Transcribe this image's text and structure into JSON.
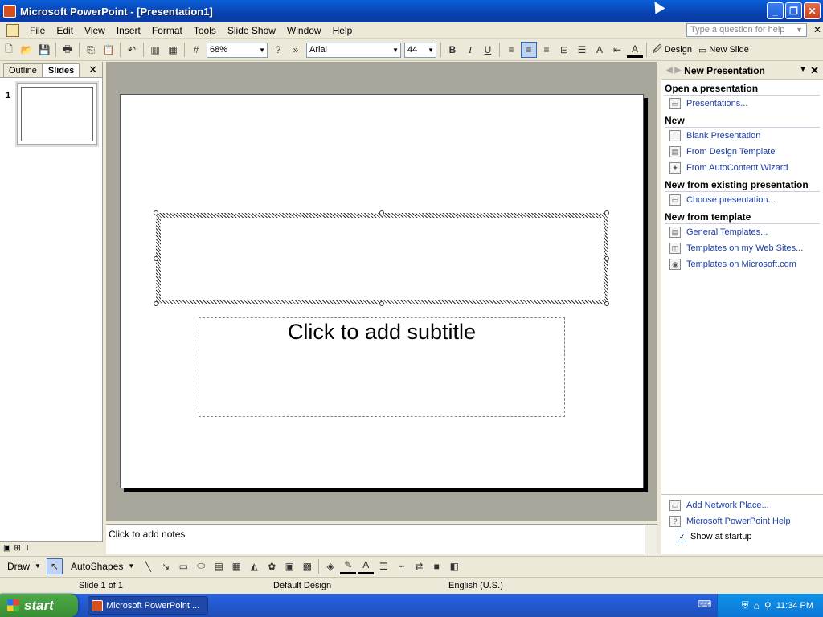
{
  "window": {
    "title": "Microsoft PowerPoint - [Presentation1]",
    "minimize": "_",
    "maximize": "❐",
    "close": "✕"
  },
  "menu": {
    "items": [
      "File",
      "Edit",
      "View",
      "Insert",
      "Format",
      "Tools",
      "Slide Show",
      "Window",
      "Help"
    ],
    "help_placeholder": "Type a question for help"
  },
  "toolbar": {
    "zoom": "68%",
    "font": "Arial",
    "font_size": "44",
    "bold": "B",
    "italic": "I",
    "underline": "U",
    "design_label": "Design",
    "new_slide_label": "New Slide"
  },
  "left_pane": {
    "tabs": [
      "Outline",
      "Slides"
    ],
    "active_tab": "Slides",
    "slide_number": "1"
  },
  "slide": {
    "subtitle_placeholder": "Click to add subtitle"
  },
  "notes": {
    "placeholder": "Click to add notes"
  },
  "task_pane": {
    "title": "New Presentation",
    "sections": [
      {
        "heading": "Open a presentation",
        "links": [
          "Presentations..."
        ]
      },
      {
        "heading": "New",
        "links": [
          "Blank Presentation",
          "From Design Template",
          "From AutoContent Wizard"
        ]
      },
      {
        "heading": "New from existing presentation",
        "links": [
          "Choose presentation..."
        ]
      },
      {
        "heading": "New from template",
        "links": [
          "General Templates...",
          "Templates on my Web Sites...",
          "Templates on Microsoft.com"
        ]
      }
    ],
    "bottom_links": [
      "Add Network Place...",
      "Microsoft PowerPoint Help"
    ],
    "show_at_startup": "Show at startup"
  },
  "draw_toolbar": {
    "draw_label": "Draw",
    "autoshapes_label": "AutoShapes"
  },
  "status_bar": {
    "slide_info": "Slide 1 of 1",
    "design": "Default Design",
    "language": "English (U.S.)"
  },
  "taskbar": {
    "start_label": "start",
    "task_item": "Microsoft PowerPoint ...",
    "clock": "11:34 PM"
  }
}
